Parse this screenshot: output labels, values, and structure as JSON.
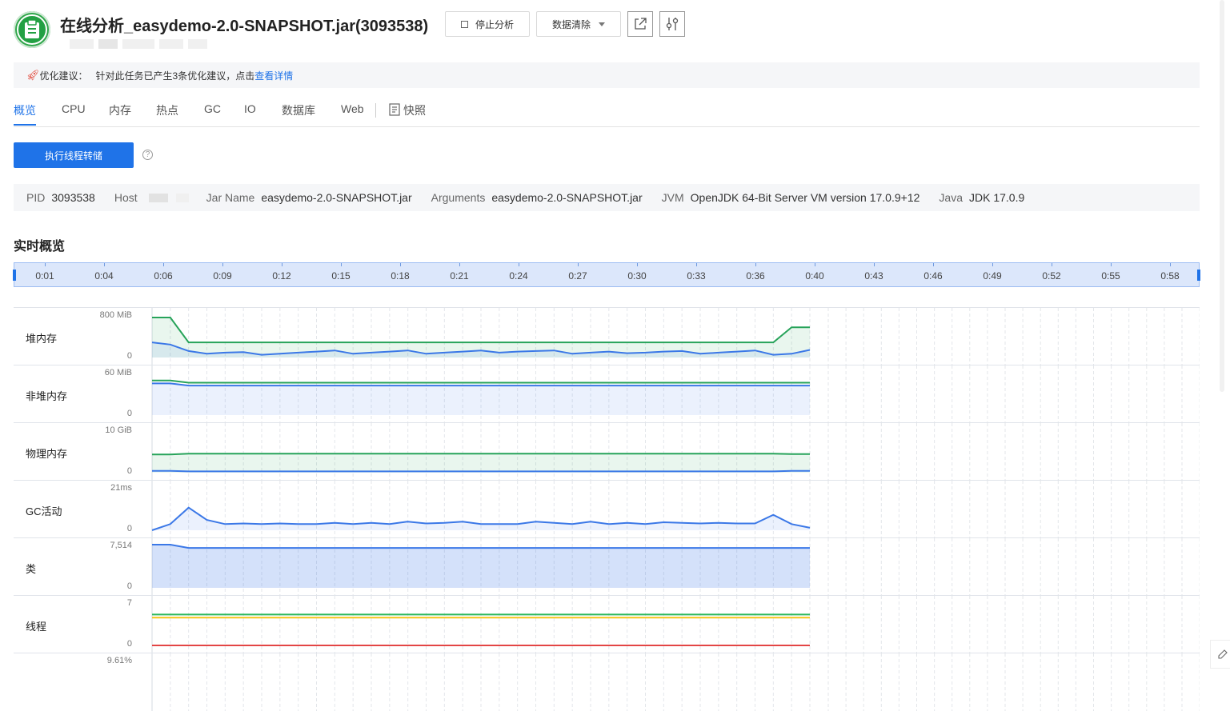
{
  "header": {
    "title": "在线分析_easydemo-2.0-SNAPSHOT.jar(3093538)",
    "stop_button": "停止分析",
    "clear_button": "数据清除",
    "logo_icon": "clipboard-icon",
    "share_icon": "external-link-icon",
    "settings_icon": "sliders-icon"
  },
  "tip": {
    "icon": "rocket-icon",
    "label": "优化建议：",
    "text": "针对此任务已产生3条优化建议，点击",
    "link": "查看详情"
  },
  "tabs": [
    {
      "label": "概览",
      "active": true
    },
    {
      "label": "CPU"
    },
    {
      "label": "内存"
    },
    {
      "label": "热点"
    },
    {
      "label": "GC"
    },
    {
      "label": "IO"
    },
    {
      "label": "数据库"
    },
    {
      "label": "Web"
    },
    {
      "label": "快照",
      "icon": "snapshot-icon"
    }
  ],
  "actions": {
    "thread_dump_button": "执行线程转储",
    "help_icon": "question-circle-icon"
  },
  "info": {
    "pid_label": "PID",
    "pid": "3093538",
    "host_label": "Host",
    "jar_label": "Jar Name",
    "jar": "easydemo-2.0-SNAPSHOT.jar",
    "args_label": "Arguments",
    "args": "easydemo-2.0-SNAPSHOT.jar",
    "jvm_label": "JVM",
    "jvm": "OpenJDK 64-Bit Server VM version 17.0.9+12",
    "java_label": "Java",
    "java": "JDK 17.0.9"
  },
  "section_title": "实时概览",
  "timeline": {
    "labels": [
      "0:01",
      "0:04",
      "0:06",
      "0:09",
      "0:12",
      "0:15",
      "0:18",
      "0:21",
      "0:24",
      "0:27",
      "0:30",
      "0:33",
      "0:36",
      "0:40",
      "0:43",
      "0:46",
      "0:49",
      "0:52",
      "0:55",
      "0:58"
    ]
  },
  "colors": {
    "accent": "#1f73e8",
    "green": "#27a35a",
    "blue": "#3b78e7",
    "yellow": "#f5c518",
    "red": "#e34545"
  },
  "chart_data": {
    "type": "line",
    "x_count": 37,
    "filled_count": 37,
    "panels": [
      {
        "name": "堆内存",
        "max_label": "800 MiB",
        "min_label": "0",
        "ylim": [
          0,
          800
        ],
        "series": [
          {
            "color": "#27a35a",
            "fill": true,
            "values": [
              740,
              740,
              280,
              280,
              280,
              280,
              280,
              280,
              280,
              280,
              280,
              280,
              280,
              280,
              280,
              280,
              280,
              280,
              280,
              280,
              280,
              280,
              280,
              280,
              280,
              280,
              280,
              280,
              280,
              280,
              280,
              280,
              280,
              280,
              280,
              560,
              560
            ]
          },
          {
            "color": "#3b78e7",
            "fill": true,
            "values": [
              280,
              240,
              120,
              70,
              90,
              100,
              50,
              70,
              90,
              110,
              130,
              70,
              90,
              110,
              130,
              70,
              90,
              110,
              130,
              90,
              110,
              120,
              130,
              70,
              90,
              110,
              80,
              90,
              110,
              120,
              70,
              90,
              110,
              130,
              50,
              70,
              140
            ]
          }
        ]
      },
      {
        "name": "非堆内存",
        "max_label": "60 MiB",
        "min_label": "0",
        "ylim": [
          0,
          60
        ],
        "series": [
          {
            "color": "#27a35a",
            "fill": false,
            "values": [
              48,
              48,
              45,
              45,
              45,
              45,
              45,
              45,
              45,
              45,
              45,
              45,
              45,
              45,
              45,
              45,
              45,
              45,
              45,
              45,
              45,
              45,
              45,
              45,
              45,
              45,
              45,
              45,
              45,
              45,
              45,
              45,
              45,
              45,
              45,
              45,
              45
            ]
          },
          {
            "color": "#3b78e7",
            "fill": true,
            "values": [
              44,
              44,
              41,
              41,
              41,
              41,
              41,
              41,
              41,
              41,
              41,
              41,
              41,
              41,
              41,
              41,
              41,
              41,
              41,
              41,
              41,
              41,
              41,
              41,
              41,
              41,
              41,
              41,
              41,
              41,
              41,
              41,
              41,
              41,
              41,
              41,
              41
            ]
          }
        ]
      },
      {
        "name": "物理内存",
        "max_label": "10 GiB",
        "min_label": "0",
        "ylim": [
          0,
          10
        ],
        "series": [
          {
            "color": "#27a35a",
            "fill": true,
            "values": [
              4.2,
              4.2,
              4.4,
              4.4,
              4.4,
              4.4,
              4.4,
              4.4,
              4.4,
              4.4,
              4.4,
              4.4,
              4.4,
              4.4,
              4.4,
              4.4,
              4.4,
              4.4,
              4.4,
              4.4,
              4.4,
              4.4,
              4.4,
              4.4,
              4.4,
              4.4,
              4.4,
              4.4,
              4.4,
              4.4,
              4.4,
              4.4,
              4.4,
              4.4,
              4.4,
              4.3,
              4.3
            ]
          },
          {
            "color": "#3b78e7",
            "fill": false,
            "values": [
              0.4,
              0.4,
              0.3,
              0.3,
              0.3,
              0.3,
              0.3,
              0.3,
              0.3,
              0.3,
              0.3,
              0.3,
              0.3,
              0.3,
              0.3,
              0.3,
              0.3,
              0.3,
              0.3,
              0.3,
              0.3,
              0.3,
              0.3,
              0.3,
              0.3,
              0.3,
              0.3,
              0.3,
              0.3,
              0.3,
              0.3,
              0.3,
              0.3,
              0.3,
              0.3,
              0.4,
              0.4
            ]
          }
        ]
      },
      {
        "name": "GC活动",
        "max_label": "21ms",
        "min_label": "0",
        "ylim": [
          0,
          21
        ],
        "series": [
          {
            "color": "#3b78e7",
            "fill": true,
            "values": [
              0,
              3,
              11,
              5,
              3,
              3.3,
              3,
              3.3,
              3,
              3,
              3.6,
              3,
              3.6,
              3,
              4.2,
              3.3,
              3.6,
              4.2,
              3,
              3,
              3,
              4.2,
              3.6,
              3,
              4.2,
              3,
              3.6,
              3,
              3.9,
              3.6,
              3.3,
              3.6,
              3.3,
              3.3,
              7.5,
              3,
              1.2
            ]
          }
        ]
      },
      {
        "name": "类",
        "max_label": "7,514",
        "min_label": "0",
        "ylim": [
          0,
          7514
        ],
        "series": [
          {
            "color": "#3b78e7",
            "fill": true,
            "values": [
              7514,
              7514,
              6950,
              6950,
              6950,
              6950,
              6950,
              6950,
              6950,
              6950,
              6950,
              6950,
              6950,
              6950,
              6950,
              6950,
              6950,
              6950,
              6950,
              6950,
              6950,
              6950,
              6950,
              6950,
              6950,
              6950,
              6950,
              6950,
              6950,
              6950,
              6950,
              6950,
              6950,
              6950,
              6950,
              6950,
              6950
            ]
          }
        ]
      },
      {
        "name": "线程",
        "max_label": "7",
        "min_label": "0",
        "ylim": [
          0,
          7
        ],
        "series": [
          {
            "color": "#2bb85c",
            "fill": false,
            "values": [
              5,
              5,
              5,
              5,
              5,
              5,
              5,
              5,
              5,
              5,
              5,
              5,
              5,
              5,
              5,
              5,
              5,
              5,
              5,
              5,
              5,
              5,
              5,
              5,
              5,
              5,
              5,
              5,
              5,
              5,
              5,
              5,
              5,
              5,
              5,
              5,
              5
            ]
          },
          {
            "color": "#f5c518",
            "fill": false,
            "values": [
              4.5,
              4.5,
              4.5,
              4.5,
              4.5,
              4.5,
              4.5,
              4.5,
              4.5,
              4.5,
              4.5,
              4.5,
              4.5,
              4.5,
              4.5,
              4.5,
              4.5,
              4.5,
              4.5,
              4.5,
              4.5,
              4.5,
              4.5,
              4.5,
              4.5,
              4.5,
              4.5,
              4.5,
              4.5,
              4.5,
              4.5,
              4.5,
              4.5,
              4.5,
              4.5,
              4.5,
              4.5
            ]
          },
          {
            "color": "#e34545",
            "fill": false,
            "values": [
              0,
              0,
              0,
              0,
              0,
              0,
              0,
              0,
              0,
              0,
              0,
              0,
              0,
              0,
              0,
              0,
              0,
              0,
              0,
              0,
              0,
              0,
              0,
              0,
              0,
              0,
              0,
              0,
              0,
              0,
              0,
              0,
              0,
              0,
              0,
              0,
              0
            ]
          }
        ]
      },
      {
        "name": "",
        "max_label": "9.61%",
        "min_label": "",
        "ylim": [
          0,
          9.61
        ],
        "series": []
      }
    ]
  }
}
